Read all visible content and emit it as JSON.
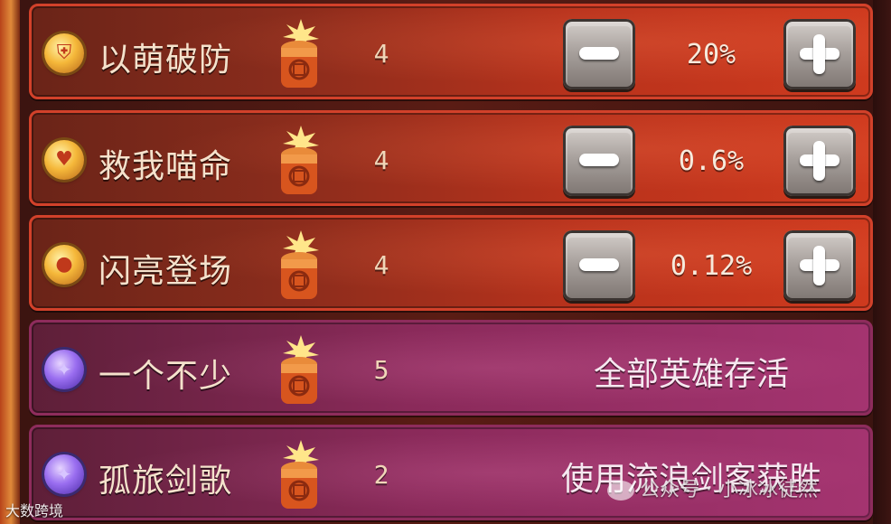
{
  "rows": [
    {
      "name": "以萌破防",
      "count": "4",
      "value": "20%",
      "theme": "red",
      "badge_icon": "broken-shield-icon",
      "badge_glyph": "⛨"
    },
    {
      "name": "救我喵命",
      "count": "4",
      "value": "0.6%",
      "theme": "red",
      "badge_icon": "heart-shield-icon",
      "badge_glyph": "♥"
    },
    {
      "name": "闪亮登场",
      "count": "4",
      "value": "0.12%",
      "theme": "red",
      "badge_icon": "gourd-icon",
      "badge_glyph": "●"
    },
    {
      "name": "一个不少",
      "count": "5",
      "condition": "全部英雄存活",
      "theme": "purple",
      "badge_icon": "purple-orb-icon",
      "badge_glyph": "✦"
    },
    {
      "name": "孤旅剑歌",
      "count": "2",
      "condition": "使用流浪剑客获胜",
      "theme": "purple",
      "badge_icon": "purple-orb-icon",
      "badge_glyph": "✦"
    }
  ],
  "watermark_left": "大数跨境",
  "watermark_right": "公众号 · 小冰冰徒然",
  "colors": {
    "red_row": "#b8321c",
    "purple_row": "#8a2a5a",
    "button_gray": "#a9a29e"
  }
}
